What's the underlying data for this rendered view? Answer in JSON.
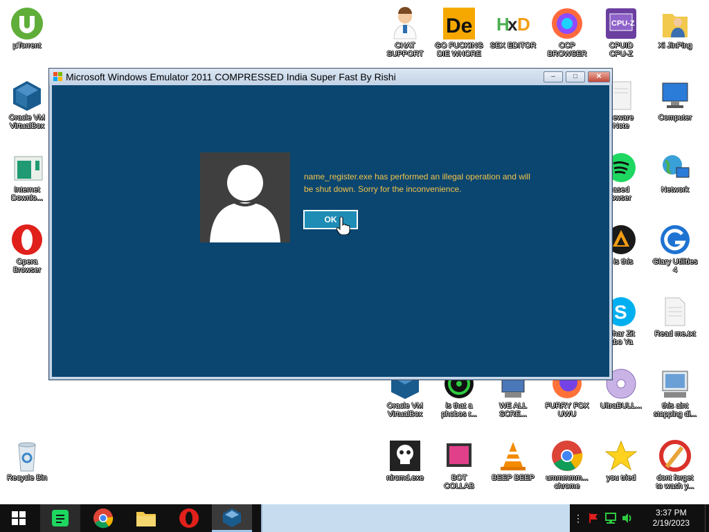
{
  "window": {
    "title": "Microsoft Windows Emulator 2011 COMPRESSED India Super Fast By Rishi"
  },
  "dialog": {
    "message": "name_register.exe has performed an illegal operation and will be shut down. Sorry for the inconvenience.",
    "ok_label": "OK"
  },
  "desktop_icons": {
    "utorrent": "µTorrent",
    "virtualbox_left": "Oracle VM\nVirtualBox",
    "internet_download": "Internet\nDownlo...",
    "opera": "Opera\nBrowser",
    "recycle_bin": "Recycle Bin",
    "chat_support": "CHAT\nSUPPORT",
    "go_die": "GO FUCKING\nDIE WHORE",
    "sex_editor": "SEX EDITOR",
    "ccp_browser": "CCP\nBROWSER",
    "cpuz": "CPUID\nCPU-Z",
    "xi_jinping": "Xi JinPing",
    "freeware_note": "eeware\nNote",
    "computer": "Computer",
    "based_browser": "ased\nowser",
    "network": "Network",
    "what_is_this": "t is this",
    "glary": "Glary Utilities\n4",
    "skype": "whar Zit\nabo Ya",
    "readme": "Read me.txt",
    "virtualbox_bottom": "Oracle VM\nVirtualBox",
    "phobos": "is that a\nphobos r...",
    "we_all_scre": "WE ALL\nSCRE...",
    "furry_fox": "FURRY FOX\nUWU",
    "ultrabull": "UltraBULL...",
    "not_stopping": "this aint\nstopping di...",
    "nircmd": "nircmd.exe",
    "bot_collab": "BOT\nCOLLAB",
    "beep": "BEEP BEEP",
    "chrome_desktop": "ummmmm...\nchrome",
    "you_tried": "you tried",
    "ccleaner": "dont forget\nto wash y..."
  },
  "taskbar": {
    "time": "3:37 PM",
    "date": "2/19/2023"
  },
  "colors": {
    "dialog_bg": "#0a4670",
    "message": "#f6c44a",
    "ok_button": "#1e8cb5",
    "titlebar": "#c8d8ea",
    "taskbar": "#101010"
  }
}
